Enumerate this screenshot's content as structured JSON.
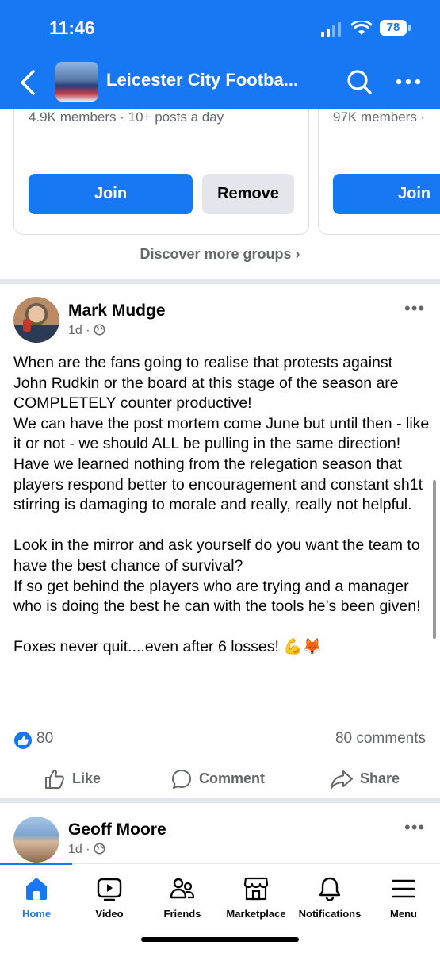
{
  "status": {
    "time": "11:46",
    "battery": "78"
  },
  "header": {
    "title": "Leicester City Footba...",
    "back_icon": "back-arrow-icon",
    "search_icon": "search-icon",
    "more_icon": "more-horizontal-icon",
    "accent": "#1877f2"
  },
  "suggested_groups": {
    "cards": [
      {
        "meta": "4.9K members · 10+ posts a day",
        "join_label": "Join",
        "remove_label": "Remove"
      },
      {
        "meta": "97K members ·",
        "join_label": "Join"
      }
    ],
    "discover_label": "Discover more groups ›"
  },
  "posts": [
    {
      "author": "Mark Mudge",
      "meta": "1d · ",
      "body": "When are the fans going to realise that protests against John Rudkin or the board at this stage of the season are COMPLETELY counter productive!\nWe can have the post mortem come June but until then - like it or not - we should ALL be pulling in the same direction!\nHave we learned nothing from the relegation season that players respond better to encouragement and constant sh1t stirring is damaging to morale and really, really not helpful.\n\nLook in the mirror and ask yourself do you want the team to have the best chance of survival?\nIf so get behind the players who are trying and a manager who is doing the best he can with the tools he’s been given!\n\nFoxes never quit....even after 6 losses! 💪🦊",
      "reactions_count": "80",
      "comments_label": "80 comments",
      "actions": {
        "like": "Like",
        "comment": "Comment",
        "share": "Share"
      }
    },
    {
      "author": "Geoff Moore",
      "meta": "1d · "
    }
  ],
  "tabbar": {
    "tabs": [
      {
        "label": "Home",
        "icon": "home-icon",
        "active": true
      },
      {
        "label": "Video",
        "icon": "video-icon"
      },
      {
        "label": "Friends",
        "icon": "friends-icon"
      },
      {
        "label": "Marketplace",
        "icon": "marketplace-icon"
      },
      {
        "label": "Notifications",
        "icon": "bell-icon"
      },
      {
        "label": "Menu",
        "icon": "menu-icon"
      }
    ]
  }
}
